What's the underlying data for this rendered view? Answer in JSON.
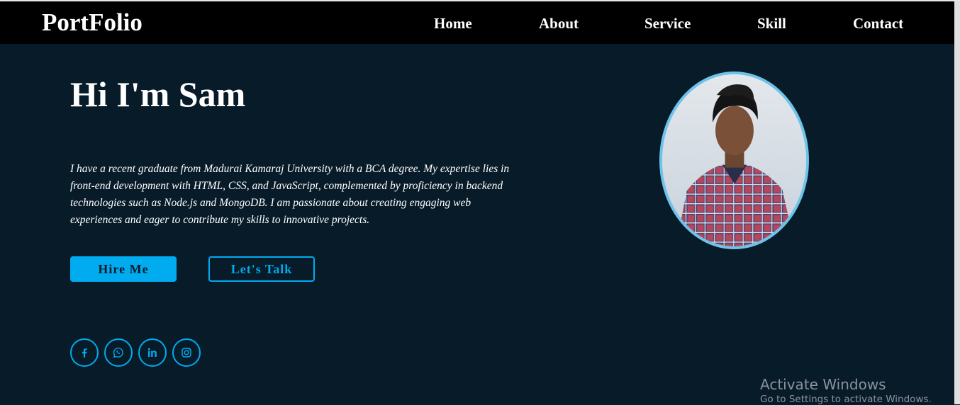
{
  "brand": {
    "logo": "PortFolio"
  },
  "nav": {
    "items": [
      {
        "label": "Home"
      },
      {
        "label": "About"
      },
      {
        "label": "Service"
      },
      {
        "label": "Skill"
      },
      {
        "label": "Contact"
      }
    ]
  },
  "hero": {
    "title": "Hi I'm Sam",
    "description": "I have a recent graduate from Madurai Kamaraj University with a BCA degree. My expertise lies in front-end development with HTML, CSS, and JavaScript, complemented by proficiency in backend technologies such as Node.js and MongoDB. I am passionate about creating engaging web experiences and eager to contribute my skills to innovative projects.",
    "buttons": {
      "primary": "Hire Me",
      "secondary": "Let's Talk"
    },
    "socials": [
      {
        "icon": "facebook-icon"
      },
      {
        "icon": "whatsapp-icon"
      },
      {
        "icon": "linkedin-icon"
      },
      {
        "icon": "instagram-icon"
      }
    ]
  },
  "watermark": {
    "title": "Activate Windows",
    "subtitle": "Go to Settings to activate Windows."
  },
  "colors": {
    "background": "#081b29",
    "navbar": "#000000",
    "accent": "#00abf0",
    "avatar_border": "#6ec3ea"
  }
}
